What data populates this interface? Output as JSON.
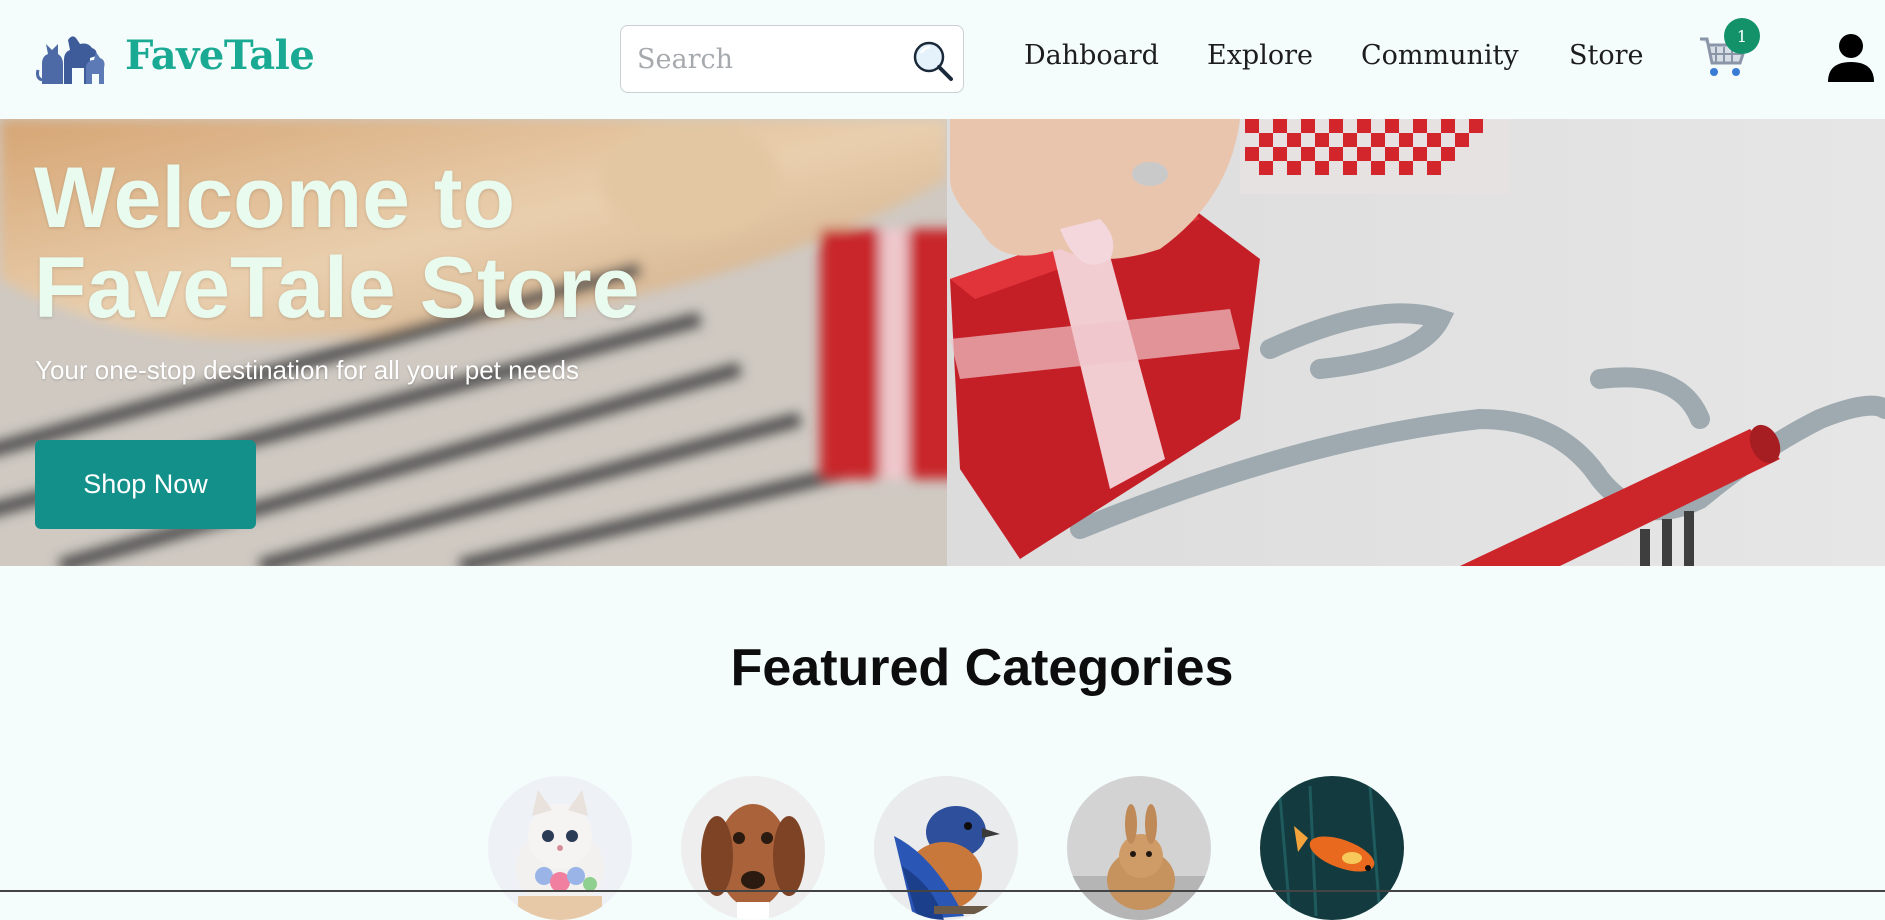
{
  "header": {
    "brand": "FaveTale",
    "search_placeholder": "Search",
    "nav": [
      "Dahboard",
      "Explore",
      "Community",
      "Store"
    ],
    "cart_count": "1",
    "colors": {
      "brand": "#1aaa93",
      "badge": "#13926a",
      "background": "#f4fcfc"
    }
  },
  "hero": {
    "title_line1": "Welcome to",
    "title_line2": "FaveTale Store",
    "subtitle": "Your one-stop destination for all your pet needs",
    "cta_label": "Shop Now",
    "colors": {
      "cta": "#14908a",
      "title": "#e9fbef"
    }
  },
  "featured": {
    "title": "Featured Categories",
    "categories": [
      "cat",
      "dog",
      "bird",
      "rabbit",
      "fish"
    ]
  }
}
